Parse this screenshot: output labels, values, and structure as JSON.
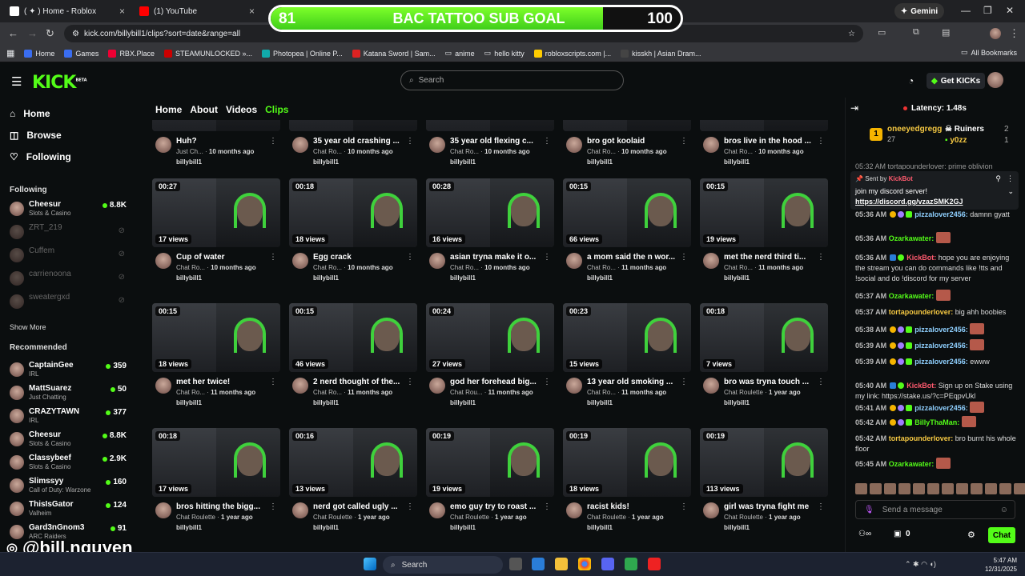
{
  "browser": {
    "tabs": [
      {
        "label": "( ✦ ) Home - Roblox",
        "icon": "roblox-icon"
      },
      {
        "label": "(1) YouTube",
        "icon": "youtube-icon"
      }
    ],
    "gemini_label": "Gemini",
    "url": "kick.com/billybill1/clips?sort=date&range=all",
    "bookmarks": [
      "Home",
      "Games",
      "RBX.Place",
      "STEAMUNLOCKED »...",
      "Photopea | Online P...",
      "Katana Sword | Sam...",
      "anime",
      "hello kitty",
      "robloxscripts.com |...",
      "kisskh | Asian Dram..."
    ],
    "all_bookmarks": "All Bookmarks"
  },
  "goal": {
    "start": "81",
    "title": "BAC TATTOO SUB GOAL",
    "end": "100",
    "progress": 0.81
  },
  "kick": {
    "logo": "KICK",
    "beta": "BETA",
    "search_placeholder": "Search",
    "get_kicks": "Get KICKs"
  },
  "sidebar": {
    "nav": [
      {
        "label": "Home",
        "icon": "home-icon"
      },
      {
        "label": "Browse",
        "icon": "browse-icon"
      },
      {
        "label": "Following",
        "icon": "heart-icon"
      }
    ],
    "following_title": "Following",
    "following": [
      {
        "name": "Cheesur",
        "category": "Slots & Casino",
        "count": "8.8K",
        "live": true
      },
      {
        "name": "ZRT_219",
        "category": "",
        "count": "",
        "live": false
      },
      {
        "name": "Cuffem",
        "category": "",
        "count": "",
        "live": false
      },
      {
        "name": "carrienoona",
        "category": "",
        "count": "",
        "live": false
      },
      {
        "name": "sweatergxd",
        "category": "",
        "count": "",
        "live": false
      }
    ],
    "show_more": "Show More",
    "recommended_title": "Recommended",
    "recommended": [
      {
        "name": "CaptainGee",
        "category": "IRL",
        "count": "359"
      },
      {
        "name": "MattSuarez",
        "category": "Just Chatting",
        "count": "50"
      },
      {
        "name": "CRAZYTAWN",
        "category": "IRL",
        "count": "377"
      },
      {
        "name": "Cheesur",
        "category": "Slots & Casino",
        "count": "8.8K"
      },
      {
        "name": "Classybeef",
        "category": "Slots & Casino",
        "count": "2.9K"
      },
      {
        "name": "Slimssyy",
        "category": "Call of Duty: Warzone",
        "count": "160"
      },
      {
        "name": "ThisIsGator",
        "category": "Valheim",
        "count": "124"
      },
      {
        "name": "Gard3nGnom3",
        "category": "ARC Raiders",
        "count": "91"
      }
    ]
  },
  "profile_tabs": [
    "Home",
    "About",
    "Videos",
    "Clips"
  ],
  "clips": [
    {
      "duration": "",
      "views": "",
      "title": "Huh?",
      "category": "Just Ch...",
      "age": "10 months ago",
      "channel": "billybill1"
    },
    {
      "duration": "",
      "views": "",
      "title": "35 year old crashing ...",
      "category": "Chat Ro...",
      "age": "10 months ago",
      "channel": "billybill1"
    },
    {
      "duration": "",
      "views": "",
      "title": "35 year old flexing c...",
      "category": "Chat Ro...",
      "age": "10 months ago",
      "channel": "billybill1"
    },
    {
      "duration": "",
      "views": "",
      "title": "bro got koolaid",
      "category": "Chat Ro...",
      "age": "10 months ago",
      "channel": "billybill1"
    },
    {
      "duration": "",
      "views": "",
      "title": "bros live in the hood ...",
      "category": "Chat Ro...",
      "age": "10 months ago",
      "channel": "billybill1"
    },
    {
      "duration": "00:27",
      "views": "17 views",
      "title": "Cup of water",
      "category": "Chat Ro...",
      "age": "10 months ago",
      "channel": "billybill1"
    },
    {
      "duration": "00:18",
      "views": "18 views",
      "title": "Egg crack",
      "category": "Chat Ro...",
      "age": "10 months ago",
      "channel": "billybill1"
    },
    {
      "duration": "00:28",
      "views": "16 views",
      "title": "asian tryna make it o...",
      "category": "Chat Ro...",
      "age": "10 months ago",
      "channel": "billybill1"
    },
    {
      "duration": "00:15",
      "views": "66 views",
      "title": "a mom said the n wor...",
      "category": "Chat Ro...",
      "age": "11 months ago",
      "channel": "billybill1"
    },
    {
      "duration": "00:15",
      "views": "19 views",
      "title": "met the nerd third ti...",
      "category": "Chat Ro...",
      "age": "11 months ago",
      "channel": "billybill1"
    },
    {
      "duration": "00:15",
      "views": "18 views",
      "title": "met her twice!",
      "category": "Chat Ro...",
      "age": "11 months ago",
      "channel": "billybill1"
    },
    {
      "duration": "00:15",
      "views": "46 views",
      "title": "2 nerd thought of the...",
      "category": "Chat Ro...",
      "age": "11 months ago",
      "channel": "billybill1"
    },
    {
      "duration": "00:24",
      "views": "27 views",
      "title": "god her forehead big...",
      "category": "Chat Rou...",
      "age": "11 months ago",
      "channel": "billybill1"
    },
    {
      "duration": "00:23",
      "views": "15 views",
      "title": "13 year old smoking ...",
      "category": "Chat Ro...",
      "age": "11 months ago",
      "channel": "billybill1"
    },
    {
      "duration": "00:18",
      "views": "7 views",
      "title": "bro was tryna touch ...",
      "category": "Chat Roulette",
      "age": "1 year ago",
      "channel": "billybill1"
    },
    {
      "duration": "00:18",
      "views": "17 views",
      "title": "bros hitting the bigg...",
      "category": "Chat Roulette",
      "age": "1 year ago",
      "channel": "billybill1"
    },
    {
      "duration": "00:16",
      "views": "13 views",
      "title": "nerd got called ugly ...",
      "category": "Chat Roulette",
      "age": "1 year ago",
      "channel": "billybill1"
    },
    {
      "duration": "00:19",
      "views": "19 views",
      "title": "emo guy try to roast ...",
      "category": "Chat Roulette",
      "age": "1 year ago",
      "channel": "billybill1"
    },
    {
      "duration": "00:19",
      "views": "18 views",
      "title": "racist kids!",
      "category": "Chat Roulette",
      "age": "1 year ago",
      "channel": "billybill1"
    },
    {
      "duration": "00:19",
      "views": "113 views",
      "title": "girl was tryna fight me",
      "category": "Chat Roulette",
      "age": "1 year ago",
      "channel": "billybill1"
    }
  ],
  "chat": {
    "latency": "Latency: 1.48s",
    "leader": {
      "name": "oneeyedgregg",
      "count": "27"
    },
    "team_a": {
      "name": "Ruiners",
      "count": "2"
    },
    "team_b": {
      "name": "y0zz",
      "count": "1"
    },
    "partial_line": "05:32 AM tortapounderlover: prime oblivion",
    "pinned": {
      "sent_by": "Sent by",
      "bot": "KickBot",
      "text": "join my discord server!",
      "link": "https://discord.gg/vzazSMK2GJ"
    },
    "messages": [
      {
        "time": "05:36 AM",
        "user": "pizzalover2456:",
        "text": "damnn gyatt",
        "color": "#8fd0ff",
        "emote": false
      },
      {
        "time": "05:36 AM",
        "user": "Ozarkawater:",
        "text": "",
        "color": "#53fc18",
        "emote": true
      },
      {
        "time": "05:36 AM",
        "user": "KickBot:",
        "text": "hope you are enjoying the stream you can do commands like !tts and !social and do !discord for my server",
        "color": "#ff5a6e",
        "emote": false
      },
      {
        "time": "05:37 AM",
        "user": "Ozarkawater:",
        "text": "",
        "color": "#53fc18",
        "emote": true
      },
      {
        "time": "05:37 AM",
        "user": "tortapounderlover:",
        "text": "big ahh boobies",
        "color": "#f5c842",
        "emote": false
      },
      {
        "time": "05:38 AM",
        "user": "pizzalover2456:",
        "text": "",
        "color": "#8fd0ff",
        "emote": true
      },
      {
        "time": "05:39 AM",
        "user": "pizzalover2456:",
        "text": "",
        "color": "#8fd0ff",
        "emote": true
      },
      {
        "time": "05:39 AM",
        "user": "pizzalover2456:",
        "text": "ewww",
        "color": "#8fd0ff",
        "emote": false
      },
      {
        "time": "05:40 AM",
        "user": "KickBot:",
        "text": "Sign up on Stake using my link: https://stake.us/?c=PEqpvUkl",
        "color": "#ff5a6e",
        "emote": false
      },
      {
        "time": "05:41 AM",
        "user": "pizzalover2456:",
        "text": "",
        "color": "#8fd0ff",
        "emote": true
      },
      {
        "time": "05:42 AM",
        "user": "BillyThaMan:",
        "text": "",
        "color": "#53fc18",
        "emote": true
      },
      {
        "time": "05:42 AM",
        "user": "tortapounderlover:",
        "text": "bro burnt his whole floor",
        "color": "#f5c842",
        "emote": false
      },
      {
        "time": "05:45 AM",
        "user": "Ozarkawater:",
        "text": "",
        "color": "#53fc18",
        "emote": true
      }
    ],
    "send_placeholder": "Send a message",
    "points": "0",
    "chat_button": "Chat"
  },
  "taskbar": {
    "search": "Search",
    "time": "5:47 AM",
    "date": "12/31/2025"
  },
  "watermark": "@bill.nguyen"
}
